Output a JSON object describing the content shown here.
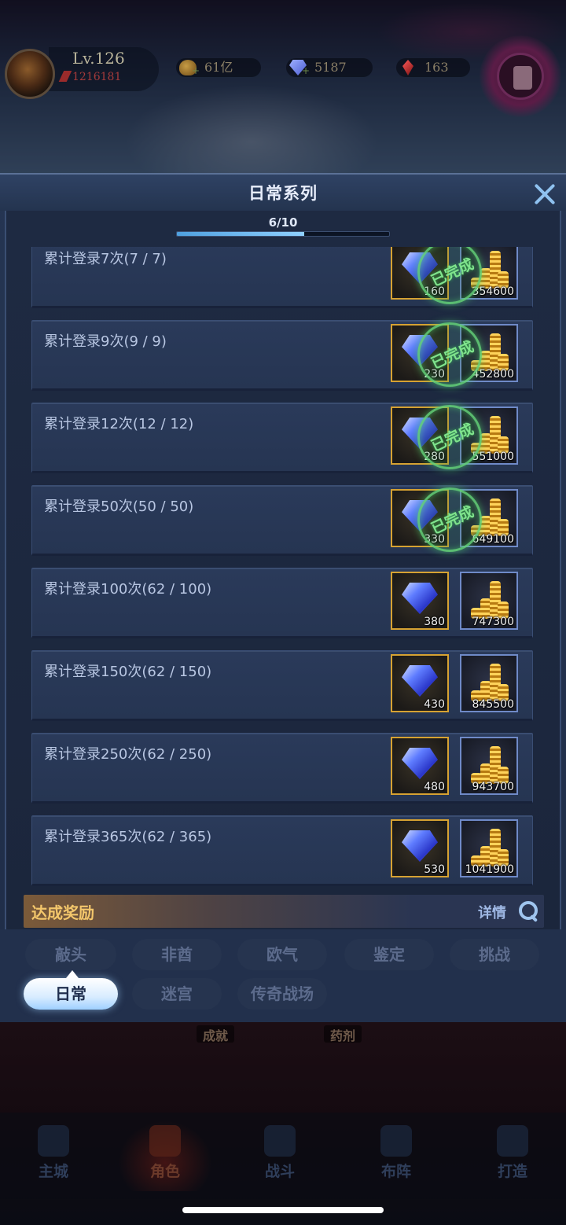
{
  "player": {
    "level": "Lv.126",
    "power": "1216181"
  },
  "currencies": {
    "gold": "61亿",
    "gems": "5187",
    "ruby": "163"
  },
  "modal": {
    "title": "日常系列",
    "progress_text": "6/10",
    "progress_fraction": 0.6
  },
  "tasks": [
    {
      "label": "累计登录7次(7 / 7)",
      "gem_count": "160",
      "gold_count": "354600",
      "completed": true,
      "stamp": "已完成"
    },
    {
      "label": "累计登录9次(9 / 9)",
      "gem_count": "230",
      "gold_count": "452800",
      "completed": true,
      "stamp": "已完成"
    },
    {
      "label": "累计登录12次(12 / 12)",
      "gem_count": "280",
      "gold_count": "551000",
      "completed": true,
      "stamp": "已完成"
    },
    {
      "label": "累计登录50次(50 / 50)",
      "gem_count": "330",
      "gold_count": "649100",
      "completed": true,
      "stamp": "已完成"
    },
    {
      "label": "累计登录100次(62 / 100)",
      "gem_count": "380",
      "gold_count": "747300",
      "completed": false,
      "stamp": ""
    },
    {
      "label": "累计登录150次(62 / 150)",
      "gem_count": "430",
      "gold_count": "845500",
      "completed": false,
      "stamp": ""
    },
    {
      "label": "累计登录250次(62 / 250)",
      "gem_count": "480",
      "gold_count": "943700",
      "completed": false,
      "stamp": ""
    },
    {
      "label": "累计登录365次(62 / 365)",
      "gem_count": "530",
      "gold_count": "1041900",
      "completed": false,
      "stamp": ""
    }
  ],
  "reward_bar": {
    "title": "达成奖励",
    "details_label": "详情"
  },
  "categories": {
    "row1": [
      "敲头",
      "非酋",
      "欧气",
      "鉴定",
      "挑战"
    ],
    "row2": [
      "日常",
      "迷宫",
      "传奇战场"
    ],
    "active": "日常"
  },
  "bottom_tags": [
    "成就",
    "药剂"
  ],
  "nav": {
    "items": [
      "主城",
      "角色",
      "战斗",
      "布阵",
      "打造"
    ],
    "active": "角色"
  },
  "colors": {
    "accent_progress": "#8fd0ff",
    "gem_frame": "#d6a232",
    "gold_frame": "#6f8ac8",
    "stamp_green": "#7fe38c"
  }
}
